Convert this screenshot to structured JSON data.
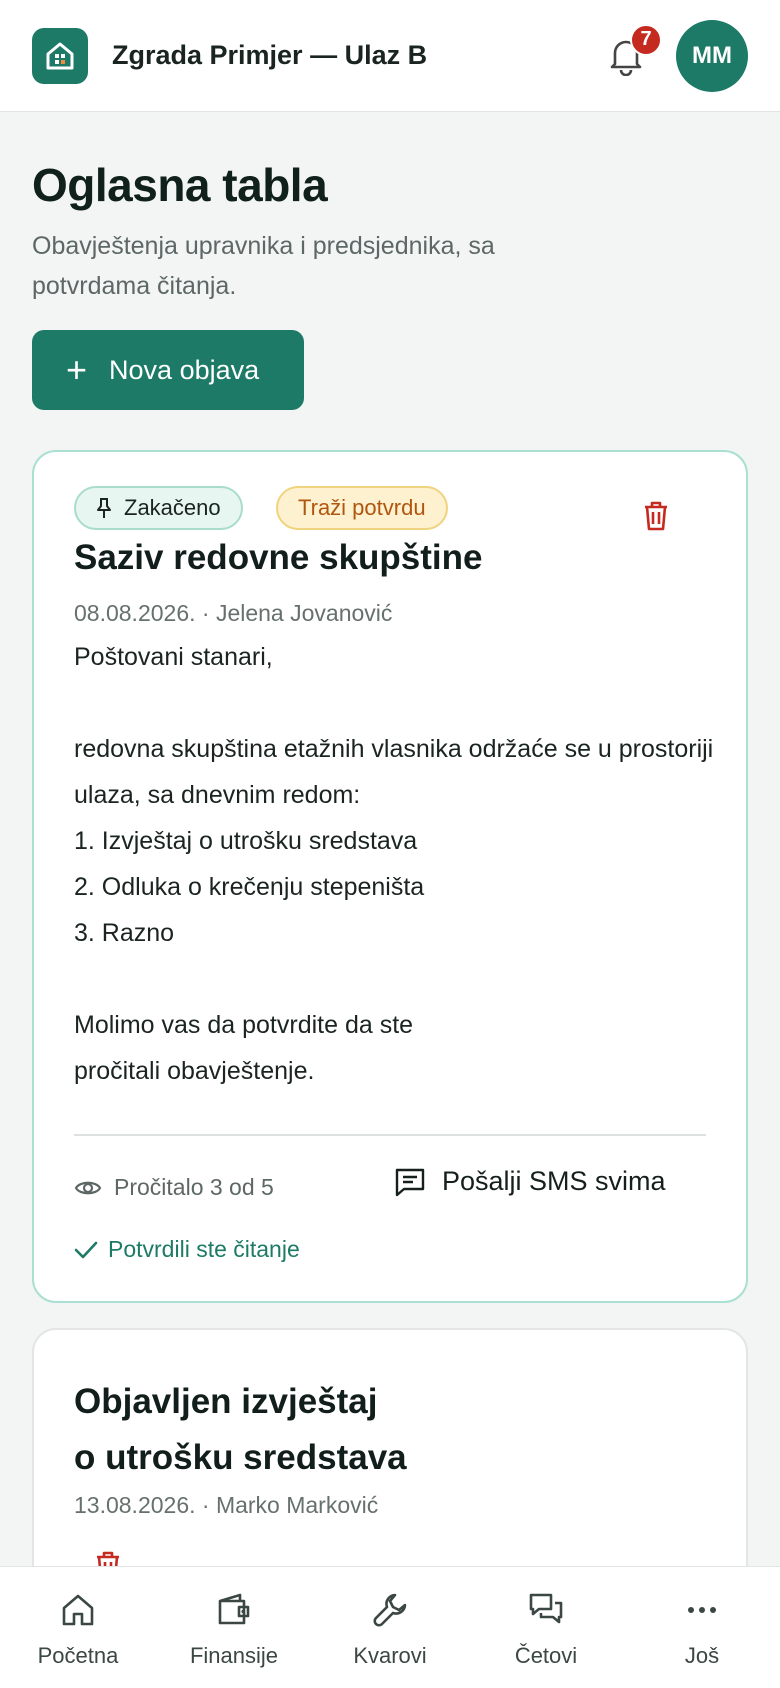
{
  "header": {
    "app_title": "Zgrada Primjer — Ulaz B",
    "notification_count": "7",
    "avatar_initials": "MM"
  },
  "page": {
    "title": "Oglasna tabla",
    "subtitle": "Obavještenja upravnika i predsjednika, sa potvrdama čitanja.",
    "new_post_label": "Nova objava"
  },
  "posts": [
    {
      "pinned_label": "Zakačeno",
      "ack_label": "Traži potvrdu",
      "title": "Saziv redovne skupštine",
      "meta": "08.08.2026. · Jelena Jovanović",
      "body": "Poštovani stanari,\n\nredovna skupština etažnih vlasnika održaće se u prostoriji ulaza, sa dnevnim redom:\n1. Izvještaj o utrošku sredstava\n2. Odluka o krečenju stepeništa\n3. Razno\n\nMolimo vas da potvrdite da ste\npročitali obavještenje.",
      "reads_label": "Pročitalo 3 od 5",
      "sms_label": "Pošalji SMS svima",
      "confirmed_label": "Potvrdili ste čitanje"
    },
    {
      "title_line1": "Objavljen izvještaj",
      "title_line2": "o utrošku sredstava",
      "meta": "13.08.2026. · Marko Marković"
    }
  ],
  "nav": [
    {
      "label": "Početna",
      "icon": "home-icon"
    },
    {
      "label": "Finansije",
      "icon": "wallet-icon"
    },
    {
      "label": "Kvarovi",
      "icon": "wrench-icon"
    },
    {
      "label": "Četovi",
      "icon": "chat-icon"
    },
    {
      "label": "Još",
      "icon": "more-icon"
    }
  ],
  "colors": {
    "primary": "#1d7a66",
    "danger": "#c42a20",
    "warning_bg": "#fdf1cf",
    "warning_text": "#b0560f"
  }
}
